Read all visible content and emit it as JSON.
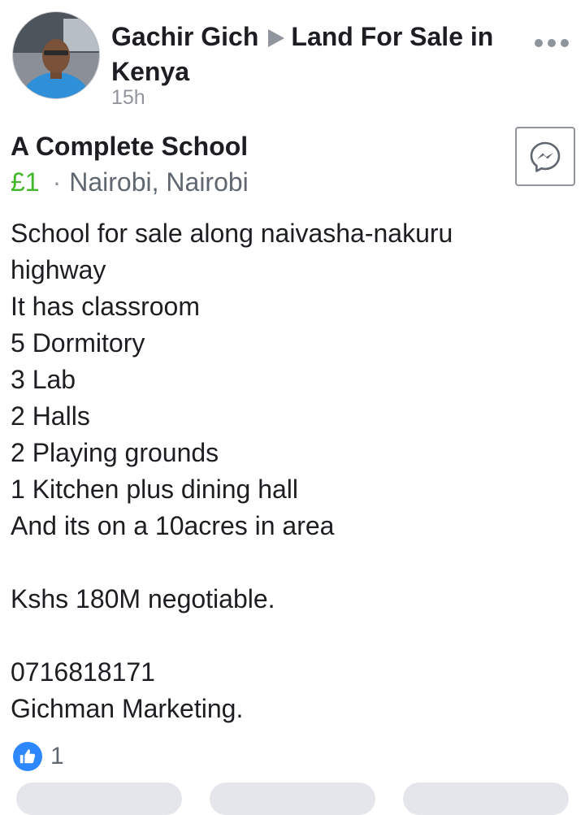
{
  "post": {
    "author": "Gachir Gich",
    "group": "Land For Sale in Kenya",
    "timestamp": "15h"
  },
  "listing": {
    "title": "A Complete School",
    "price": "£1",
    "separator": "·",
    "location": "Nairobi, Nairobi",
    "description_lines": [
      "School for sale along naivasha-nakuru",
      "highway",
      "It has classroom",
      "5 Dormitory",
      "3 Lab",
      "2 Halls",
      "2 Playing grounds",
      "1 Kitchen plus dining hall",
      "And its on a 10acres in area",
      "",
      "Kshs 180M negotiable.",
      "",
      "0716818171",
      "Gichman Marketing."
    ]
  },
  "reactions": {
    "like_count": "1"
  },
  "icons": {
    "more": "more-horizontal-icon",
    "messenger": "messenger-icon",
    "like": "thumbs-up-icon"
  },
  "colors": {
    "price": "#42b72a",
    "like_badge": "#2d88ff",
    "secondary_text": "#90949c"
  }
}
